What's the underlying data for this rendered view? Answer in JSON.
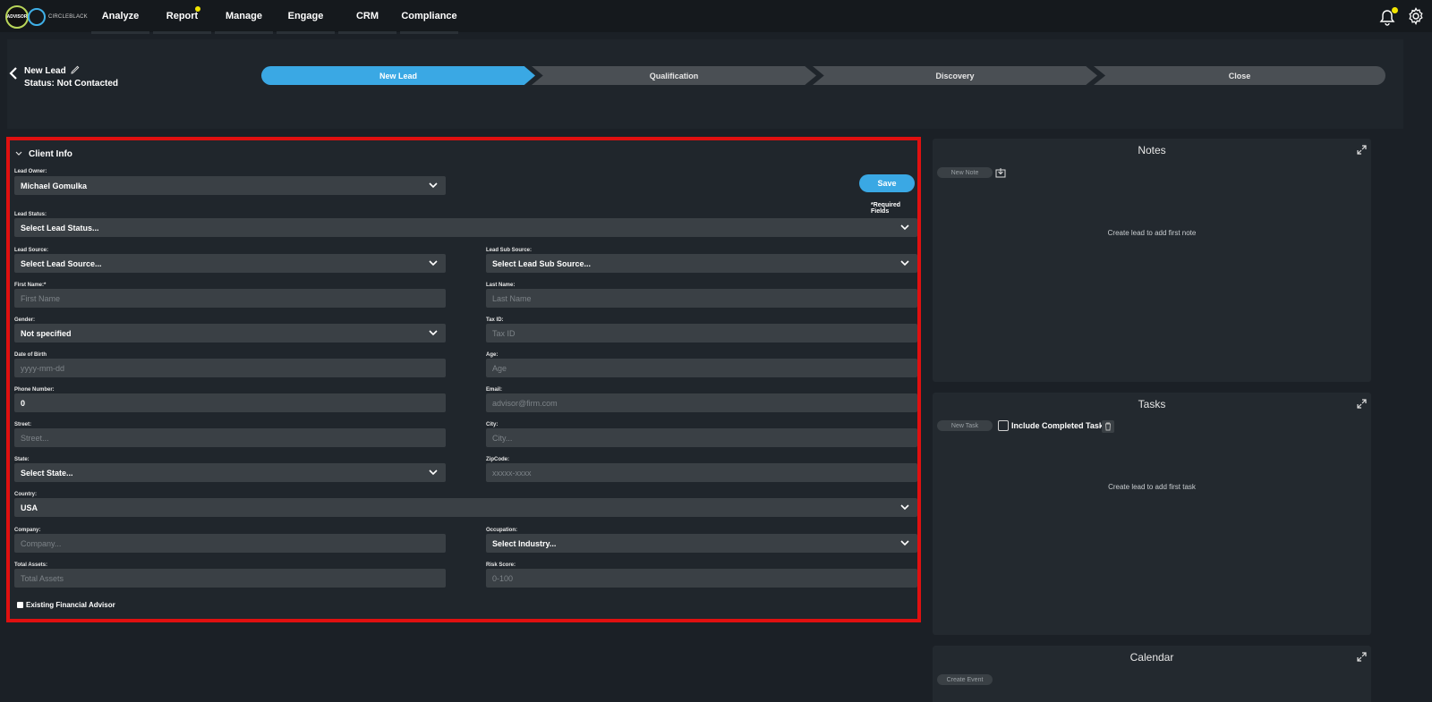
{
  "nav": {
    "logo_badge": "ADVISOR",
    "logo_text": "CIRCLEBLACK",
    "items": [
      "Analyze",
      "Report",
      "Manage",
      "Engage",
      "CRM",
      "Compliance"
    ]
  },
  "colors": {
    "accent": "#3aa8e4",
    "highlight": "#e01010",
    "notify_dot": "#f2e500"
  },
  "lead": {
    "title": "New Lead",
    "status": "Status: Not Contacted"
  },
  "stages": [
    {
      "label": "New Lead",
      "active": true
    },
    {
      "label": "Qualification",
      "active": false
    },
    {
      "label": "Discovery",
      "active": false
    },
    {
      "label": "Close",
      "active": false
    }
  ],
  "client_info": {
    "header": "Client Info",
    "save_label": "Save",
    "required_note": "*Required Fields",
    "lead_owner": {
      "label": "Lead Owner:",
      "value": "Michael Gomulka"
    },
    "lead_status": {
      "label": "Lead Status:",
      "value": "Select Lead Status..."
    },
    "lead_source": {
      "label": "Lead Source:",
      "value": "Select Lead Source..."
    },
    "lead_sub_source": {
      "label": "Lead Sub Source:",
      "value": "Select Lead Sub Source..."
    },
    "first_name": {
      "label": "First Name:*",
      "placeholder": "First Name"
    },
    "last_name": {
      "label": "Last Name:",
      "placeholder": "Last Name"
    },
    "gender": {
      "label": "Gender:",
      "value": "Not specified"
    },
    "tax_id": {
      "label": "Tax ID:",
      "placeholder": "Tax ID"
    },
    "dob": {
      "label": "Date of Birth",
      "placeholder": "yyyy-mm-dd"
    },
    "age": {
      "label": "Age:",
      "placeholder": "Age"
    },
    "phone": {
      "label": "Phone Number:",
      "value": "0"
    },
    "email": {
      "label": "Email:",
      "placeholder": "advisor@firm.com"
    },
    "street": {
      "label": "Street:",
      "placeholder": "Street..."
    },
    "city": {
      "label": "City:",
      "placeholder": "City..."
    },
    "state": {
      "label": "State:",
      "value": "Select State..."
    },
    "zip": {
      "label": "ZipCode:",
      "placeholder": "xxxxx-xxxx"
    },
    "country": {
      "label": "Country:",
      "value": "USA"
    },
    "company": {
      "label": "Company:",
      "placeholder": "Company..."
    },
    "occupation": {
      "label": "Occupation:",
      "value": "Select Industry..."
    },
    "total_assets": {
      "label": "Total Assets:",
      "placeholder": "Total Assets"
    },
    "risk_score": {
      "label": "Risk Score:",
      "placeholder": "0-100"
    },
    "existing_advisor": {
      "label": "Existing Financial Advisor",
      "checked": true
    }
  },
  "notes": {
    "title": "Notes",
    "new_label": "New Note",
    "empty": "Create lead to add first note"
  },
  "tasks": {
    "title": "Tasks",
    "new_label": "New Task",
    "include_label": "Include Completed Tasks",
    "empty": "Create lead to add first task"
  },
  "calendar": {
    "title": "Calendar",
    "create_label": "Create Event"
  }
}
